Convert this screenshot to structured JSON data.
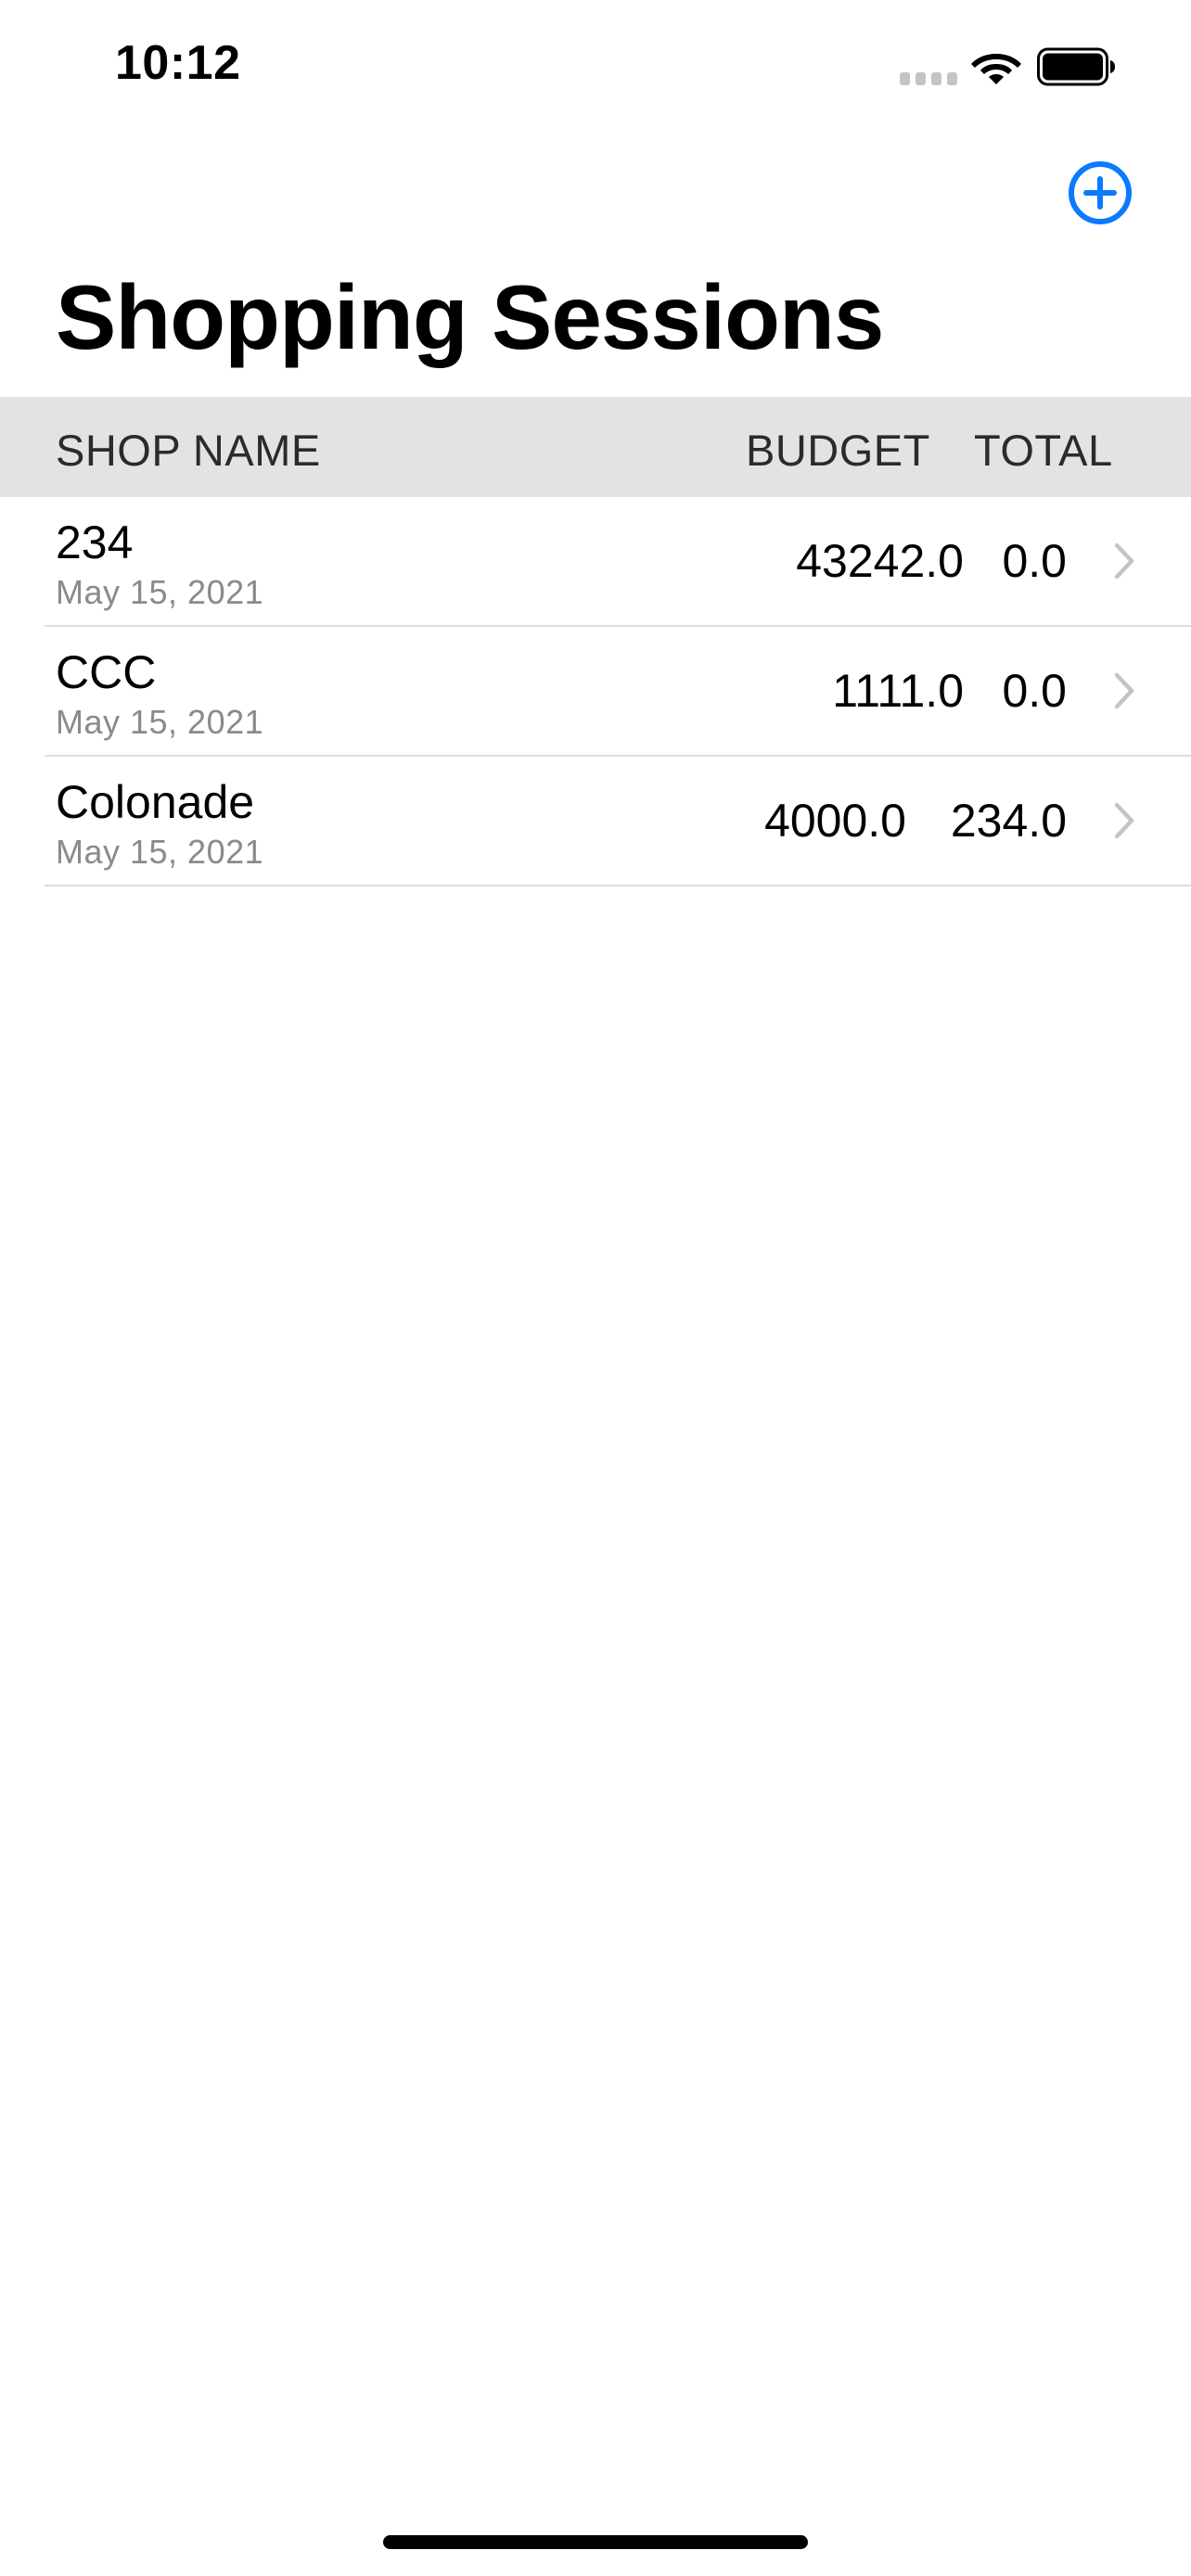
{
  "status_bar": {
    "time": "10:12",
    "icons": [
      "cellular-signal-icon",
      "wifi-icon",
      "battery-icon"
    ]
  },
  "nav": {
    "add_icon": "plus-circle-icon",
    "title": "Shopping Sessions"
  },
  "table": {
    "headers": {
      "shop_name": "SHOP NAME",
      "budget": "BUDGET",
      "total": "TOTAL"
    },
    "rows": [
      {
        "name": "234",
        "date": "May 15, 2021",
        "budget": "43242.0",
        "total": "0.0"
      },
      {
        "name": "CCC",
        "date": "May 15, 2021",
        "budget": "1111.0",
        "total": "0.0"
      },
      {
        "name": "Colonade",
        "date": "May 15, 2021",
        "budget": "4000.0",
        "total": "234.0"
      }
    ],
    "row_icon": "chevron-right-icon"
  },
  "colors": {
    "accent": "#0a7aff",
    "header_background": "#e3e3e3",
    "secondary_text": "#8a8a8e",
    "chevron": "#c4c4c7",
    "separator": "#dcdcdc"
  }
}
